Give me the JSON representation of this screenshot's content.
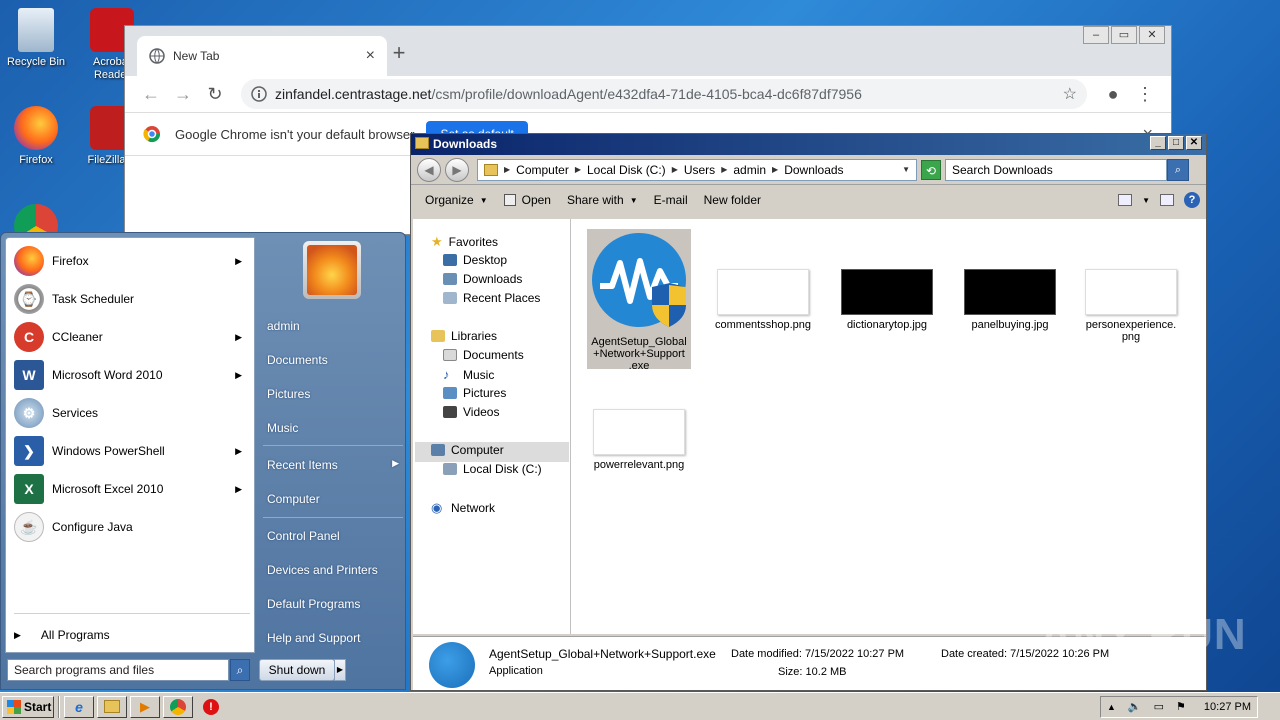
{
  "desktop": {
    "icons": [
      {
        "label": "Recycle Bin"
      },
      {
        "label": "Acrobat Reader"
      },
      {
        "label": "Firefox"
      },
      {
        "label": "FileZilla C"
      }
    ]
  },
  "chrome": {
    "tab_title": "New Tab",
    "url_host": "zinfandel.centrastage.net",
    "url_path": "/csm/profile/downloadAgent/e432dfa4-71de-4105-bca4-dc6f87df7956",
    "infobar_message": "Google Chrome isn't your default browser",
    "infobar_button": "Set as default"
  },
  "start_menu": {
    "programs": [
      {
        "label": "Firefox",
        "icon": "firefox-icon",
        "has_submenu": true
      },
      {
        "label": "Task Scheduler",
        "icon": "clock-icon",
        "has_submenu": false
      },
      {
        "label": "CCleaner",
        "icon": "ccleaner-icon",
        "has_submenu": true
      },
      {
        "label": "Microsoft Word 2010",
        "icon": "word-icon",
        "has_submenu": true
      },
      {
        "label": "Services",
        "icon": "gears-icon",
        "has_submenu": false
      },
      {
        "label": "Windows PowerShell",
        "icon": "powershell-icon",
        "has_submenu": true
      },
      {
        "label": "Microsoft Excel 2010",
        "icon": "excel-icon",
        "has_submenu": true
      },
      {
        "label": "Configure Java",
        "icon": "java-icon",
        "has_submenu": false
      }
    ],
    "all_programs": "All Programs",
    "search_placeholder": "Search programs and files",
    "right_items": {
      "user": "admin",
      "documents": "Documents",
      "pictures": "Pictures",
      "music": "Music",
      "recent_items": "Recent Items",
      "computer": "Computer",
      "control_panel": "Control Panel",
      "devices_printers": "Devices and Printers",
      "default_programs": "Default Programs",
      "help_support": "Help and Support"
    },
    "shutdown": "Shut down"
  },
  "explorer": {
    "title": "Downloads",
    "breadcrumb": [
      "Computer",
      "Local Disk (C:)",
      "Users",
      "admin",
      "Downloads"
    ],
    "search_placeholder": "Search Downloads",
    "toolbar": {
      "organize": "Organize",
      "open": "Open",
      "share_with": "Share with",
      "email": "E-mail",
      "new_folder": "New folder"
    },
    "nav": {
      "favorites": "Favorites",
      "desktop": "Desktop",
      "downloads": "Downloads",
      "recent_places": "Recent Places",
      "libraries": "Libraries",
      "documents": "Documents",
      "music": "Music",
      "pictures": "Pictures",
      "videos": "Videos",
      "computer": "Computer",
      "local_disk": "Local Disk (C:)",
      "network": "Network"
    },
    "files": [
      {
        "name": "AgentSetup_Global+Network+Support.exe",
        "l1": "AgentSetup_Global",
        "l2": "+Network+Support",
        "l3": ".exe"
      },
      {
        "name": "commentsshop.png"
      },
      {
        "name": "dictionarytop.jpg"
      },
      {
        "name": "panelbuying.jpg"
      },
      {
        "name": "personexperience.png",
        "l1": "personexperience.",
        "l2": "png"
      },
      {
        "name": "powerrelevant.png"
      }
    ],
    "details": {
      "filename": "AgentSetup_Global+Network+Support.exe",
      "type": "Application",
      "date_modified_label": "Date modified:",
      "date_modified": "7/15/2022 10:27 PM",
      "date_created_label": "Date created:",
      "date_created": "7/15/2022 10:26 PM",
      "size_label": "Size:",
      "size": "10.2 MB"
    }
  },
  "taskbar": {
    "start_label": "Start",
    "clock": "10:27 PM"
  },
  "watermark": "ANY RUN"
}
